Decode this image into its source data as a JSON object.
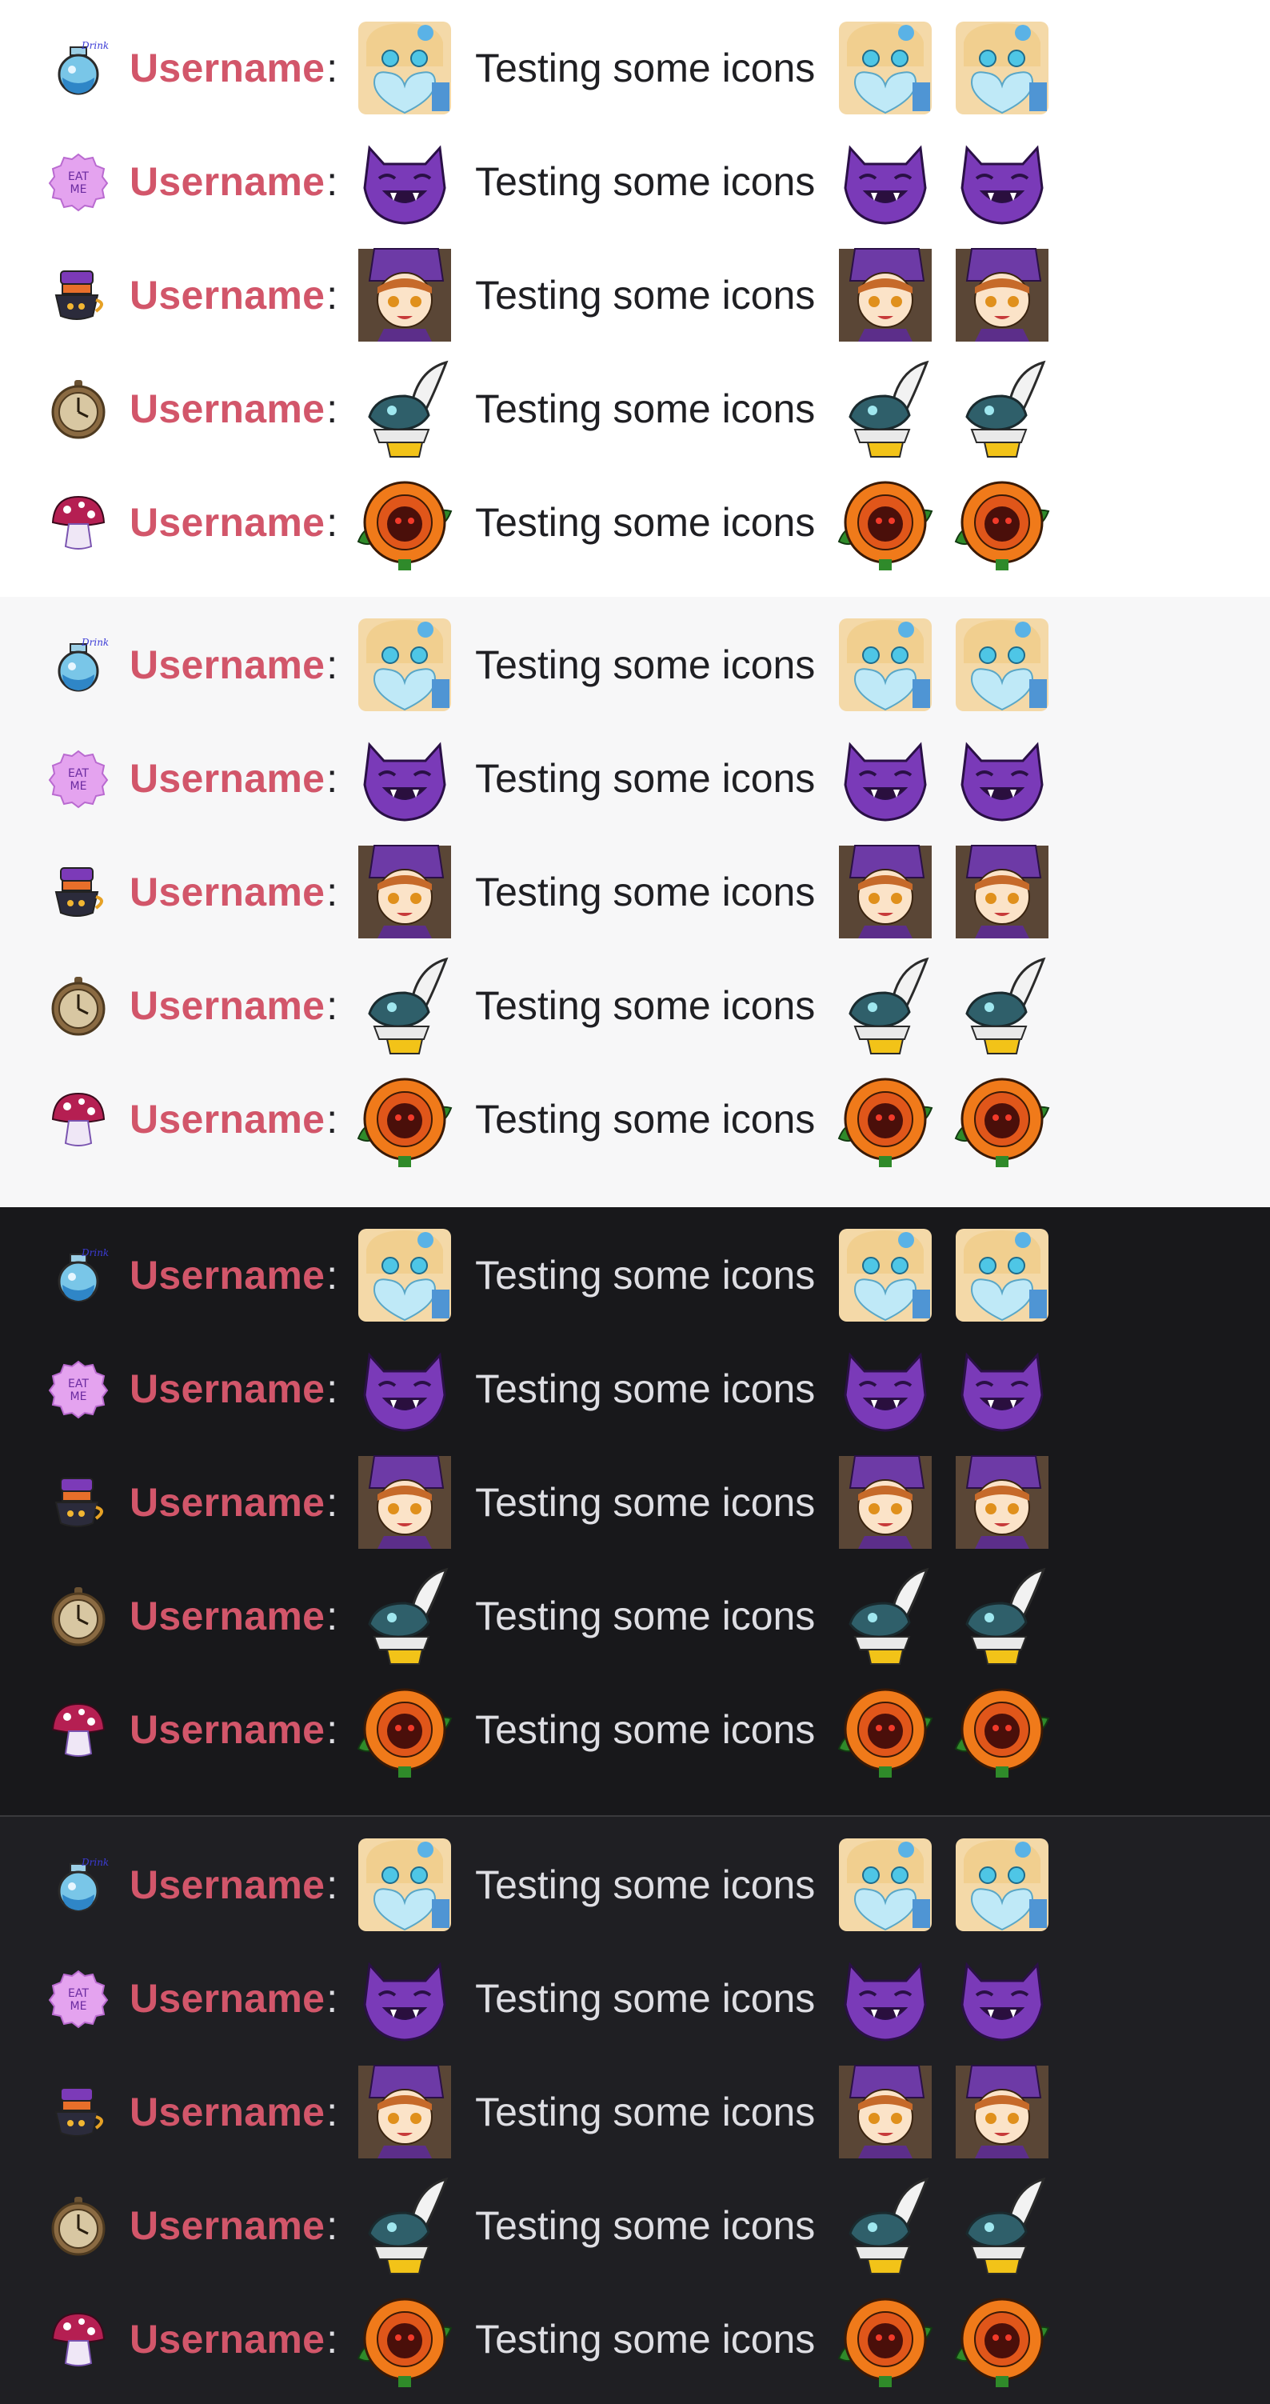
{
  "colors": {
    "username": "#d2566a",
    "panel_backgrounds": [
      "#ffffff",
      "#f7f7f8",
      "#18181b",
      "#1f1f23"
    ]
  },
  "panels": [
    {
      "theme": "light",
      "rows": [
        {
          "badge": "drink-me-potion-icon",
          "username": "Username",
          "colon": ":",
          "message": "Testing some icons",
          "emote": "alice-heart-emote"
        },
        {
          "badge": "eat-me-cookie-icon",
          "username": "Username",
          "colon": ":",
          "message": "Testing some icons",
          "emote": "purple-cat-emote"
        },
        {
          "badge": "teacup-stack-icon",
          "username": "Username",
          "colon": ":",
          "message": "Testing some icons",
          "emote": "hatter-girl-emote"
        },
        {
          "badge": "pocket-watch-icon",
          "username": "Username",
          "colon": ":",
          "message": "Testing some icons",
          "emote": "white-rabbit-emote"
        },
        {
          "badge": "mushroom-icon",
          "username": "Username",
          "colon": ":",
          "message": "Testing some icons",
          "emote": "orange-rose-emote"
        }
      ]
    },
    {
      "theme": "light",
      "rows": [
        {
          "badge": "drink-me-potion-icon",
          "username": "Username",
          "colon": ":",
          "message": "Testing some icons",
          "emote": "alice-heart-emote"
        },
        {
          "badge": "eat-me-cookie-icon",
          "username": "Username",
          "colon": ":",
          "message": "Testing some icons",
          "emote": "purple-cat-emote"
        },
        {
          "badge": "teacup-stack-icon",
          "username": "Username",
          "colon": ":",
          "message": "Testing some icons",
          "emote": "hatter-girl-emote"
        },
        {
          "badge": "pocket-watch-icon",
          "username": "Username",
          "colon": ":",
          "message": "Testing some icons",
          "emote": "white-rabbit-emote"
        },
        {
          "badge": "mushroom-icon",
          "username": "Username",
          "colon": ":",
          "message": "Testing some icons",
          "emote": "orange-rose-emote"
        }
      ]
    },
    {
      "theme": "dark",
      "rows": [
        {
          "badge": "drink-me-potion-icon",
          "username": "Username",
          "colon": ":",
          "message": "Testing some icons",
          "emote": "alice-heart-emote"
        },
        {
          "badge": "eat-me-cookie-icon",
          "username": "Username",
          "colon": ":",
          "message": "Testing some icons",
          "emote": "purple-cat-emote"
        },
        {
          "badge": "teacup-stack-icon",
          "username": "Username",
          "colon": ":",
          "message": "Testing some icons",
          "emote": "hatter-girl-emote"
        },
        {
          "badge": "pocket-watch-icon",
          "username": "Username",
          "colon": ":",
          "message": "Testing some icons",
          "emote": "white-rabbit-emote"
        },
        {
          "badge": "mushroom-icon",
          "username": "Username",
          "colon": ":",
          "message": "Testing some icons",
          "emote": "orange-rose-emote"
        }
      ]
    },
    {
      "theme": "dark",
      "rows": [
        {
          "badge": "drink-me-potion-icon",
          "username": "Username",
          "colon": ":",
          "message": "Testing some icons",
          "emote": "alice-heart-emote"
        },
        {
          "badge": "eat-me-cookie-icon",
          "username": "Username",
          "colon": ":",
          "message": "Testing some icons",
          "emote": "purple-cat-emote"
        },
        {
          "badge": "teacup-stack-icon",
          "username": "Username",
          "colon": ":",
          "message": "Testing some icons",
          "emote": "hatter-girl-emote"
        },
        {
          "badge": "pocket-watch-icon",
          "username": "Username",
          "colon": ":",
          "message": "Testing some icons",
          "emote": "white-rabbit-emote"
        },
        {
          "badge": "mushroom-icon",
          "username": "Username",
          "colon": ":",
          "message": "Testing some icons",
          "emote": "orange-rose-emote"
        }
      ]
    }
  ]
}
